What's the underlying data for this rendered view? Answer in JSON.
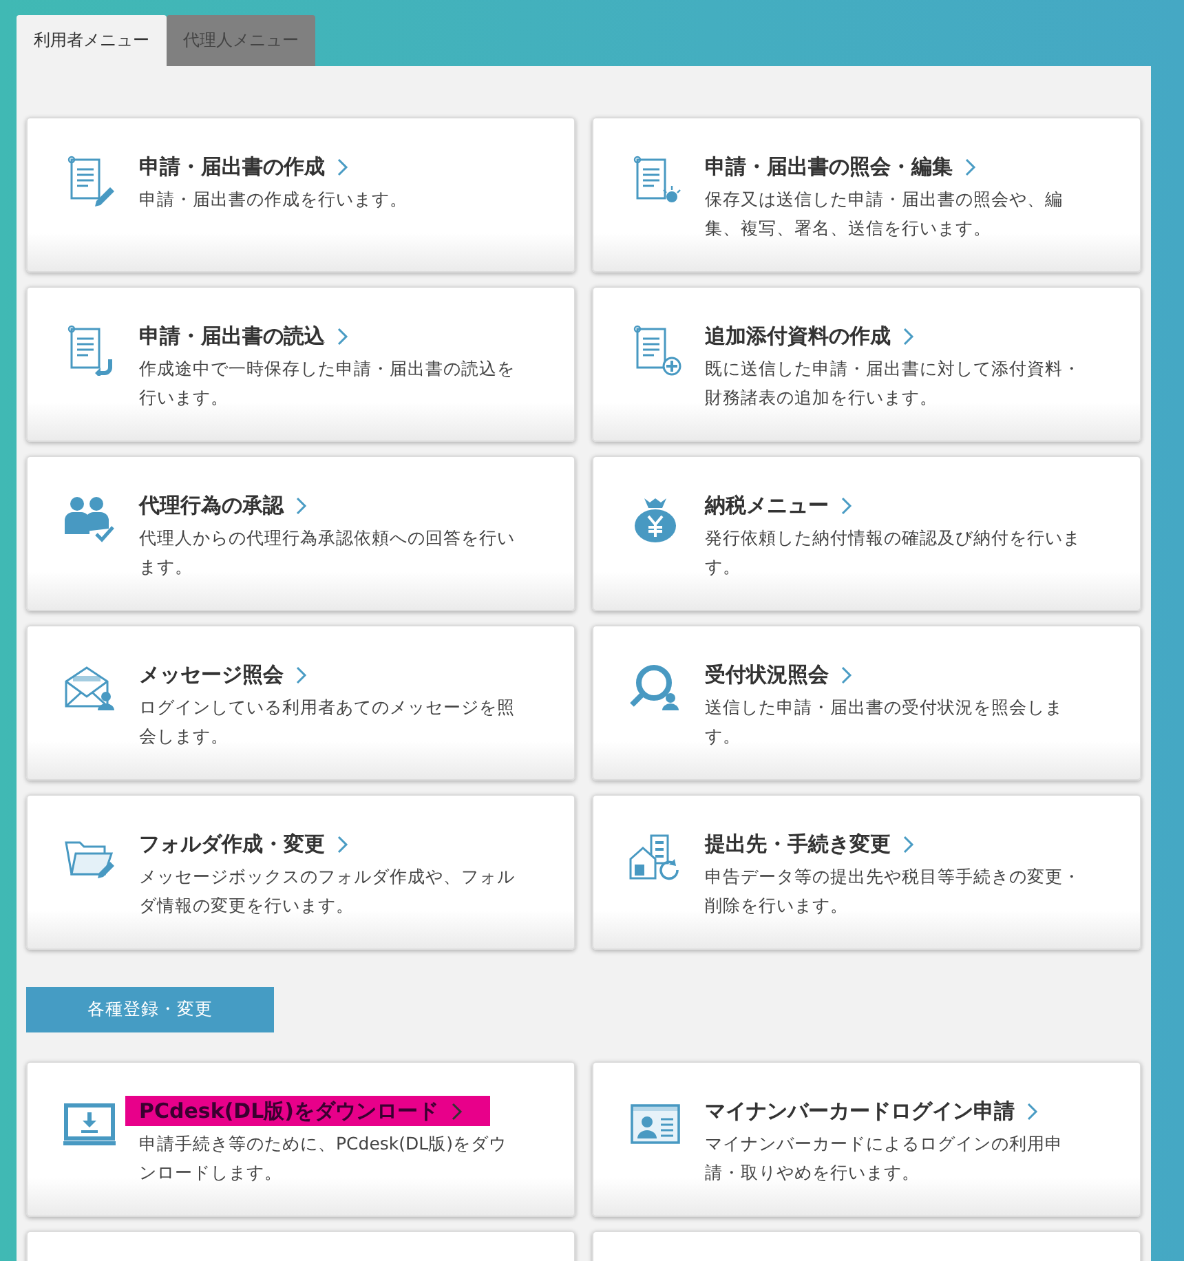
{
  "tabs": [
    {
      "label": "利用者メニュー",
      "selected": true
    },
    {
      "label": "代理人メニュー",
      "selected": false
    }
  ],
  "menu_cards": [
    {
      "kind": "card",
      "title": "申請・届出書の作成",
      "description": "申請・届出書の作成を行います。",
      "highlighted": false
    },
    {
      "kind": "card",
      "title": "申請・届出書の照会・編集",
      "description": "保存又は送信した申請・届出書の照会や、編集、複写、署名、送信を行います。",
      "highlighted": false
    },
    {
      "kind": "card",
      "title": "申請・届出書の読込",
      "description": "作成途中で一時保存した申請・届出書の読込を行います。",
      "highlighted": false
    },
    {
      "kind": "card",
      "title": "追加添付資料の作成",
      "description": "既に送信した申請・届出書に対して添付資料・財務諸表の追加を行います。",
      "highlighted": false
    },
    {
      "kind": "card",
      "title": "代理行為の承認",
      "description": "代理人からの代理行為承認依頼への回答を行います。",
      "highlighted": false
    },
    {
      "kind": "card",
      "title": "納税メニュー",
      "description": "発行依頼した納付情報の確認及び納付を行います。",
      "highlighted": false
    },
    {
      "kind": "card",
      "title": "メッセージ照会",
      "description": "ログインしている利用者あてのメッセージを照会します。",
      "highlighted": false
    },
    {
      "kind": "card",
      "title": "受付状況照会",
      "description": "送信した申請・届出書の受付状況を照会します。",
      "highlighted": false
    },
    {
      "kind": "card",
      "title": "フォルダ作成・変更",
      "description": "メッセージボックスのフォルダ作成や、フォルダ情報の変更を行います。",
      "highlighted": false
    },
    {
      "kind": "card",
      "title": "提出先・手続き変更",
      "description": "申告データ等の提出先や税目等手続きの変更・削除を行います。",
      "highlighted": false
    }
  ],
  "section_header": {
    "label": "各種登録・変更"
  },
  "registration_cards": [
    {
      "kind": "card",
      "title": "PCdesk(DL版)をダウンロード",
      "description": "申請手続き等のために、PCdesk(DL版)をダウンロードします。",
      "highlighted": true
    },
    {
      "kind": "card",
      "title": "マイナンバーカードログイン申請",
      "description": "マイナンバーカードによるログインの利用申請・取りやめを行います。",
      "highlighted": false
    },
    {
      "kind": "blank"
    },
    {
      "kind": "blank"
    }
  ]
}
